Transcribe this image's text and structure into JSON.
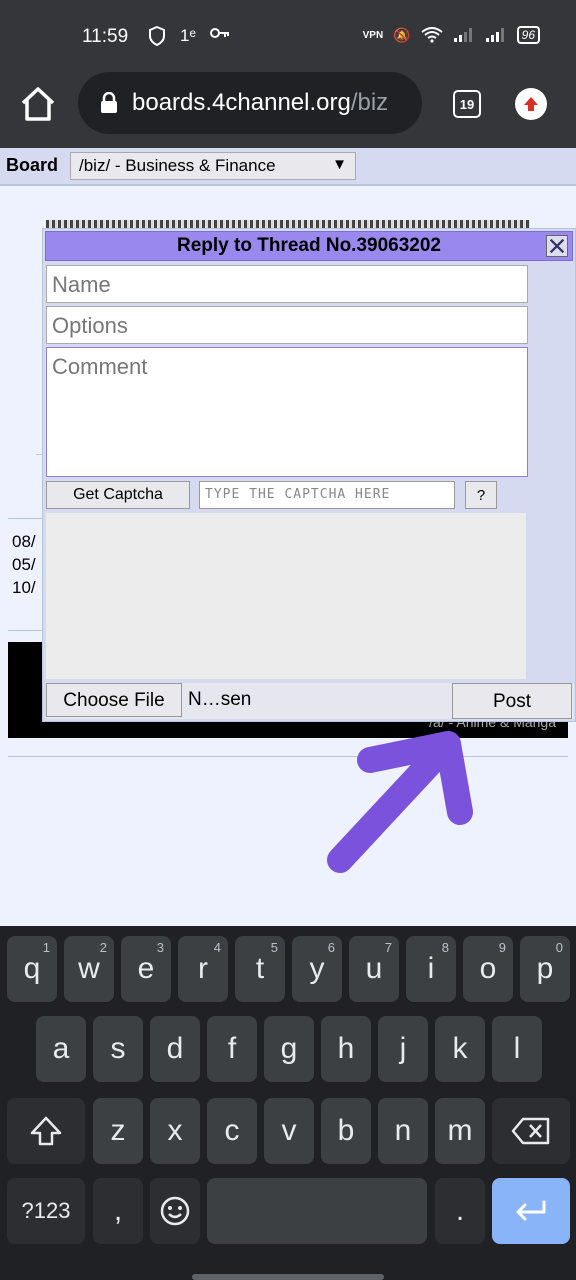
{
  "status_bar": {
    "time": "11:59",
    "left_icons": [
      "shield-icon",
      "1ᵉ",
      "key-icon"
    ],
    "battery": "96"
  },
  "browser": {
    "url_host": "boards.4channel.org",
    "url_path": "/biz",
    "tab_count": "19"
  },
  "board_bar": {
    "label": "Board",
    "selected": "/biz/ - Business & Finance",
    "arrow": "▼"
  },
  "background": {
    "dates": [
      "08/",
      "05/",
      "10/"
    ],
    "banner_caption": "/a/ - Anime & Manga"
  },
  "quick_reply": {
    "title": "Reply to Thread No.39063202",
    "name_placeholder": "Name",
    "options_placeholder": "Options",
    "comment_placeholder": "Comment",
    "captcha_button": "Get Captcha",
    "captcha_placeholder": "TYPE THE CAPTCHA HERE",
    "captcha_help": "?",
    "choose_file": "Choose File",
    "file_name": "N…sen",
    "post": "Post"
  },
  "keyboard": {
    "row1": [
      {
        "k": "q",
        "h": "1"
      },
      {
        "k": "w",
        "h": "2"
      },
      {
        "k": "e",
        "h": "3"
      },
      {
        "k": "r",
        "h": "4"
      },
      {
        "k": "t",
        "h": "5"
      },
      {
        "k": "y",
        "h": "6"
      },
      {
        "k": "u",
        "h": "7"
      },
      {
        "k": "i",
        "h": "8"
      },
      {
        "k": "o",
        "h": "9"
      },
      {
        "k": "p",
        "h": "0"
      }
    ],
    "row2": [
      "a",
      "s",
      "d",
      "f",
      "g",
      "h",
      "j",
      "k",
      "l"
    ],
    "row3": [
      "z",
      "x",
      "c",
      "v",
      "b",
      "n",
      "m"
    ],
    "symbols": "?123",
    "comma": ",",
    "period": "."
  }
}
